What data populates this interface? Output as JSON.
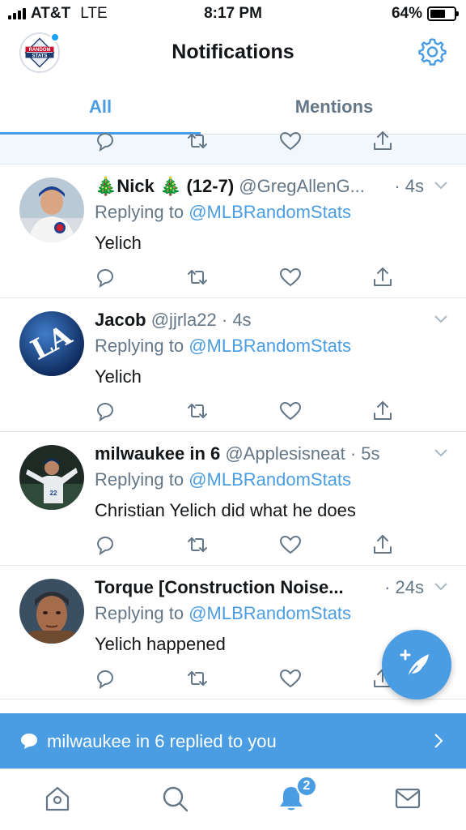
{
  "status_bar": {
    "carrier": "AT&T",
    "network": "LTE",
    "time": "8:17 PM",
    "battery_percent": "64%",
    "battery_level": 0.64
  },
  "header": {
    "title": "Notifications",
    "profile_logo_text": "RANDOM STATS",
    "settings_icon": "gear-icon"
  },
  "tabs": [
    {
      "label": "All",
      "active": true
    },
    {
      "label": "Mentions",
      "active": false
    }
  ],
  "tweets": [
    {
      "name": "🎄Nick 🎄 (12-7)",
      "handle": "@GregAllenG...",
      "time": "· 4s",
      "reply_prefix": "Replying to ",
      "reply_to": "@MLBRandomStats",
      "text": "Yelich"
    },
    {
      "name": "Jacob",
      "handle": "@jjrla22",
      "time": "· 4s",
      "reply_prefix": "Replying to ",
      "reply_to": "@MLBRandomStats",
      "text": "Yelich"
    },
    {
      "name": "milwaukee in 6",
      "handle": "@Applesisneat",
      "time": "· 5s",
      "reply_prefix": "Replying to ",
      "reply_to": "@MLBRandomStats",
      "text": "Christian Yelich did what he does"
    },
    {
      "name": "Torque [Construction Noise...",
      "handle": "",
      "time": "· 24s",
      "reply_prefix": "Replying to ",
      "reply_to": "@MLBRandomStats",
      "text": "Yelich happened"
    }
  ],
  "toast": {
    "text": "milwaukee in 6 replied to you"
  },
  "tab_bar": {
    "items": [
      "home-icon",
      "search-icon",
      "bell-icon",
      "mail-icon"
    ],
    "notification_badge": "2"
  },
  "colors": {
    "accent": "#4a9de3",
    "text": "#14171a",
    "secondary": "#657786"
  }
}
